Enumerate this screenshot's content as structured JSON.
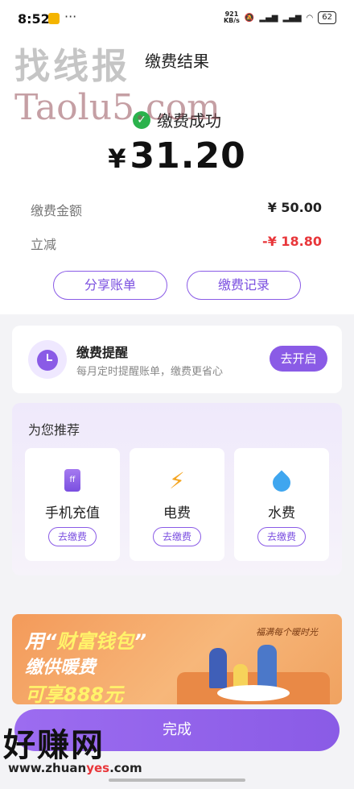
{
  "status_bar": {
    "time": "8:52",
    "more": "···",
    "network_speed_value": "921",
    "network_speed_unit": "KB/s",
    "battery": "62"
  },
  "header": {
    "title": "缴费结果"
  },
  "watermarks": {
    "top_cn": "找线报",
    "top_en": "Taolu5.com",
    "bottom_cn": "好赚网",
    "bottom_url_a": "www.zhuan",
    "bottom_url_b": "yes",
    "bottom_url_c": ".com"
  },
  "result": {
    "status": "缴费成功",
    "currency": "¥",
    "amount": "31.20",
    "rows": [
      {
        "label": "缴费金额",
        "value": "¥ 50.00"
      },
      {
        "label": "立减",
        "value": "-¥ 18.80"
      }
    ],
    "share_label": "分享账单",
    "records_label": "缴费记录"
  },
  "reminder": {
    "title": "缴费提醒",
    "subtitle": "每月定时提醒账单，缴费更省心",
    "button": "去开启"
  },
  "recommend": {
    "title": "为您推荐",
    "items": [
      {
        "label": "手机充值",
        "action": "去缴费",
        "icon": "phone-icon"
      },
      {
        "label": "电费",
        "action": "去缴费",
        "icon": "lightning-icon"
      },
      {
        "label": "水费",
        "action": "去缴费",
        "icon": "water-drop-icon"
      }
    ]
  },
  "banner": {
    "line1_a": "用“",
    "line1_b": "财富钱包",
    "line1_c": "”",
    "line2": "缴供暖费",
    "line3": "可享888元",
    "tagline": "福满每个暖时光"
  },
  "done_label": "完成",
  "colors": {
    "accent": "#8a5be6",
    "success": "#2bb24c",
    "discount": "#e8363a"
  }
}
